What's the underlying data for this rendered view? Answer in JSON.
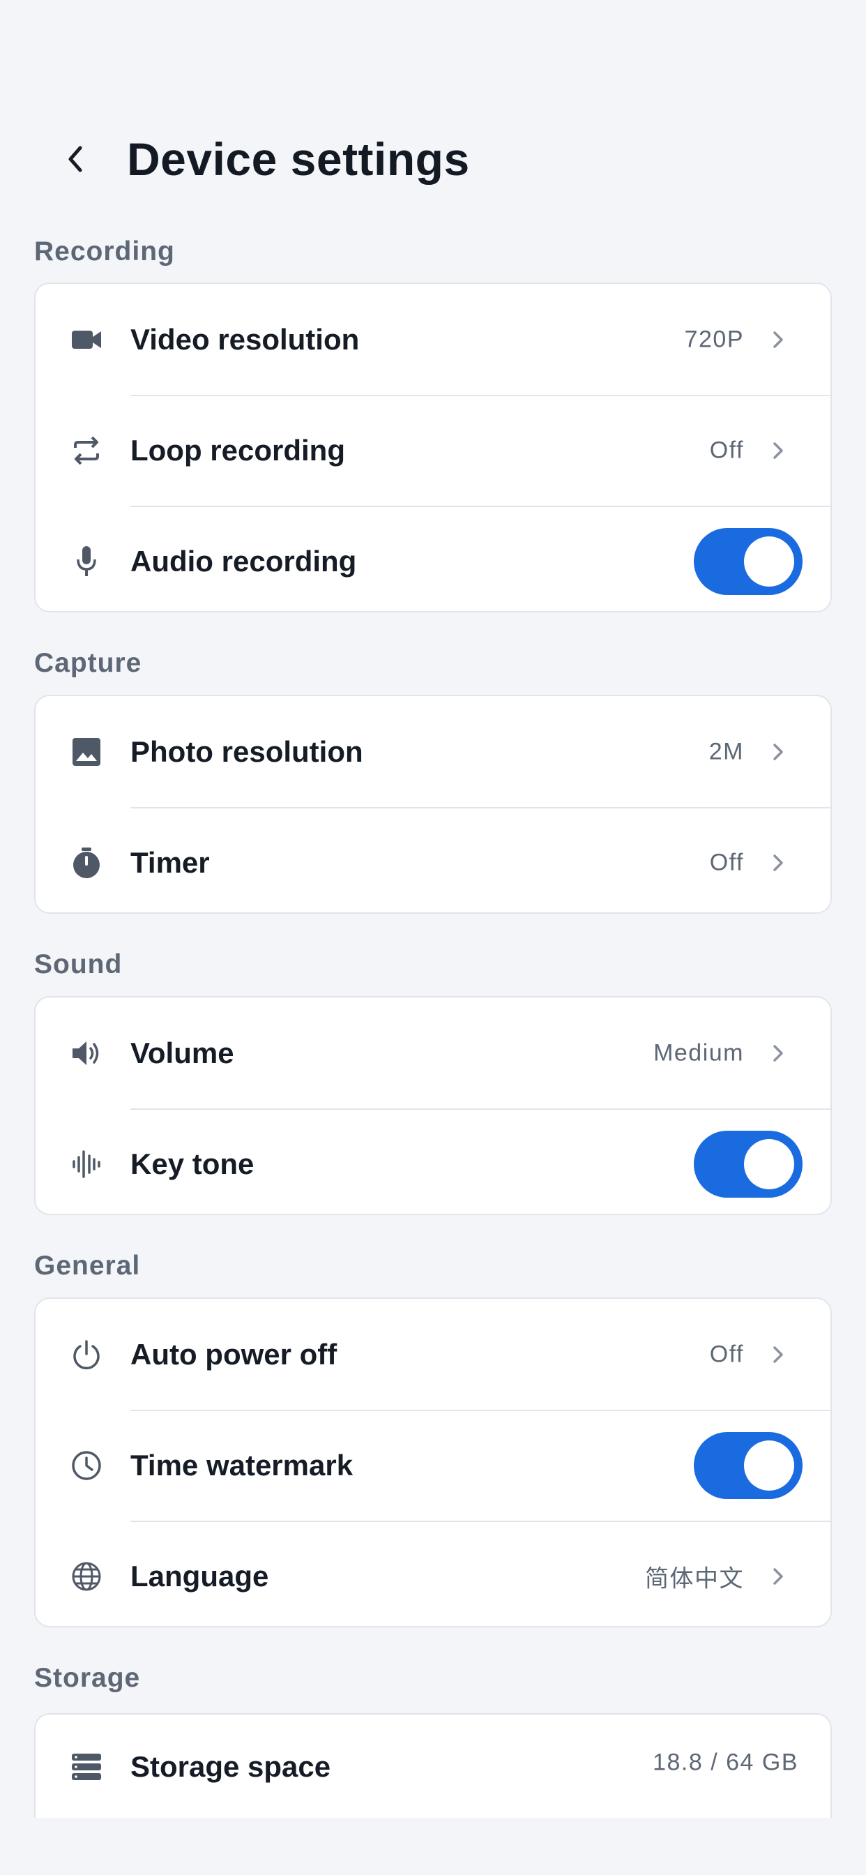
{
  "header": {
    "title": "Device settings"
  },
  "colors": {
    "accent": "#1a6be0",
    "background": "#f3f5f8",
    "card": "#ffffff",
    "muted_text": "#5d6775"
  },
  "sections": {
    "recording": {
      "label": "Recording",
      "video_resolution": {
        "icon": "video-camera-icon",
        "label": "Video resolution",
        "value": "720P"
      },
      "loop_recording": {
        "icon": "loop-icon",
        "label": "Loop recording",
        "value": "Off"
      },
      "audio_recording": {
        "icon": "microphone-icon",
        "label": "Audio recording",
        "enabled": true
      }
    },
    "capture": {
      "label": "Capture",
      "photo_resolution": {
        "icon": "image-icon",
        "label": "Photo resolution",
        "value": "2M"
      },
      "timer": {
        "icon": "timer-icon",
        "label": "Timer",
        "value": "Off"
      }
    },
    "sound": {
      "label": "Sound",
      "volume": {
        "icon": "speaker-icon",
        "label": "Volume",
        "value": "Medium"
      },
      "key_tone": {
        "icon": "waveform-icon",
        "label": "Key tone",
        "enabled": true
      }
    },
    "general": {
      "label": "General",
      "auto_power_off": {
        "icon": "power-icon",
        "label": "Auto power off",
        "value": "Off"
      },
      "time_watermark": {
        "icon": "clock-icon",
        "label": "Time watermark",
        "enabled": true
      },
      "language": {
        "icon": "globe-icon",
        "label": "Language",
        "value": "简体中文"
      }
    },
    "storage": {
      "label": "Storage",
      "storage_space": {
        "icon": "storage-icon",
        "label": "Storage space",
        "value": "18.8 / 64 GB"
      }
    }
  }
}
